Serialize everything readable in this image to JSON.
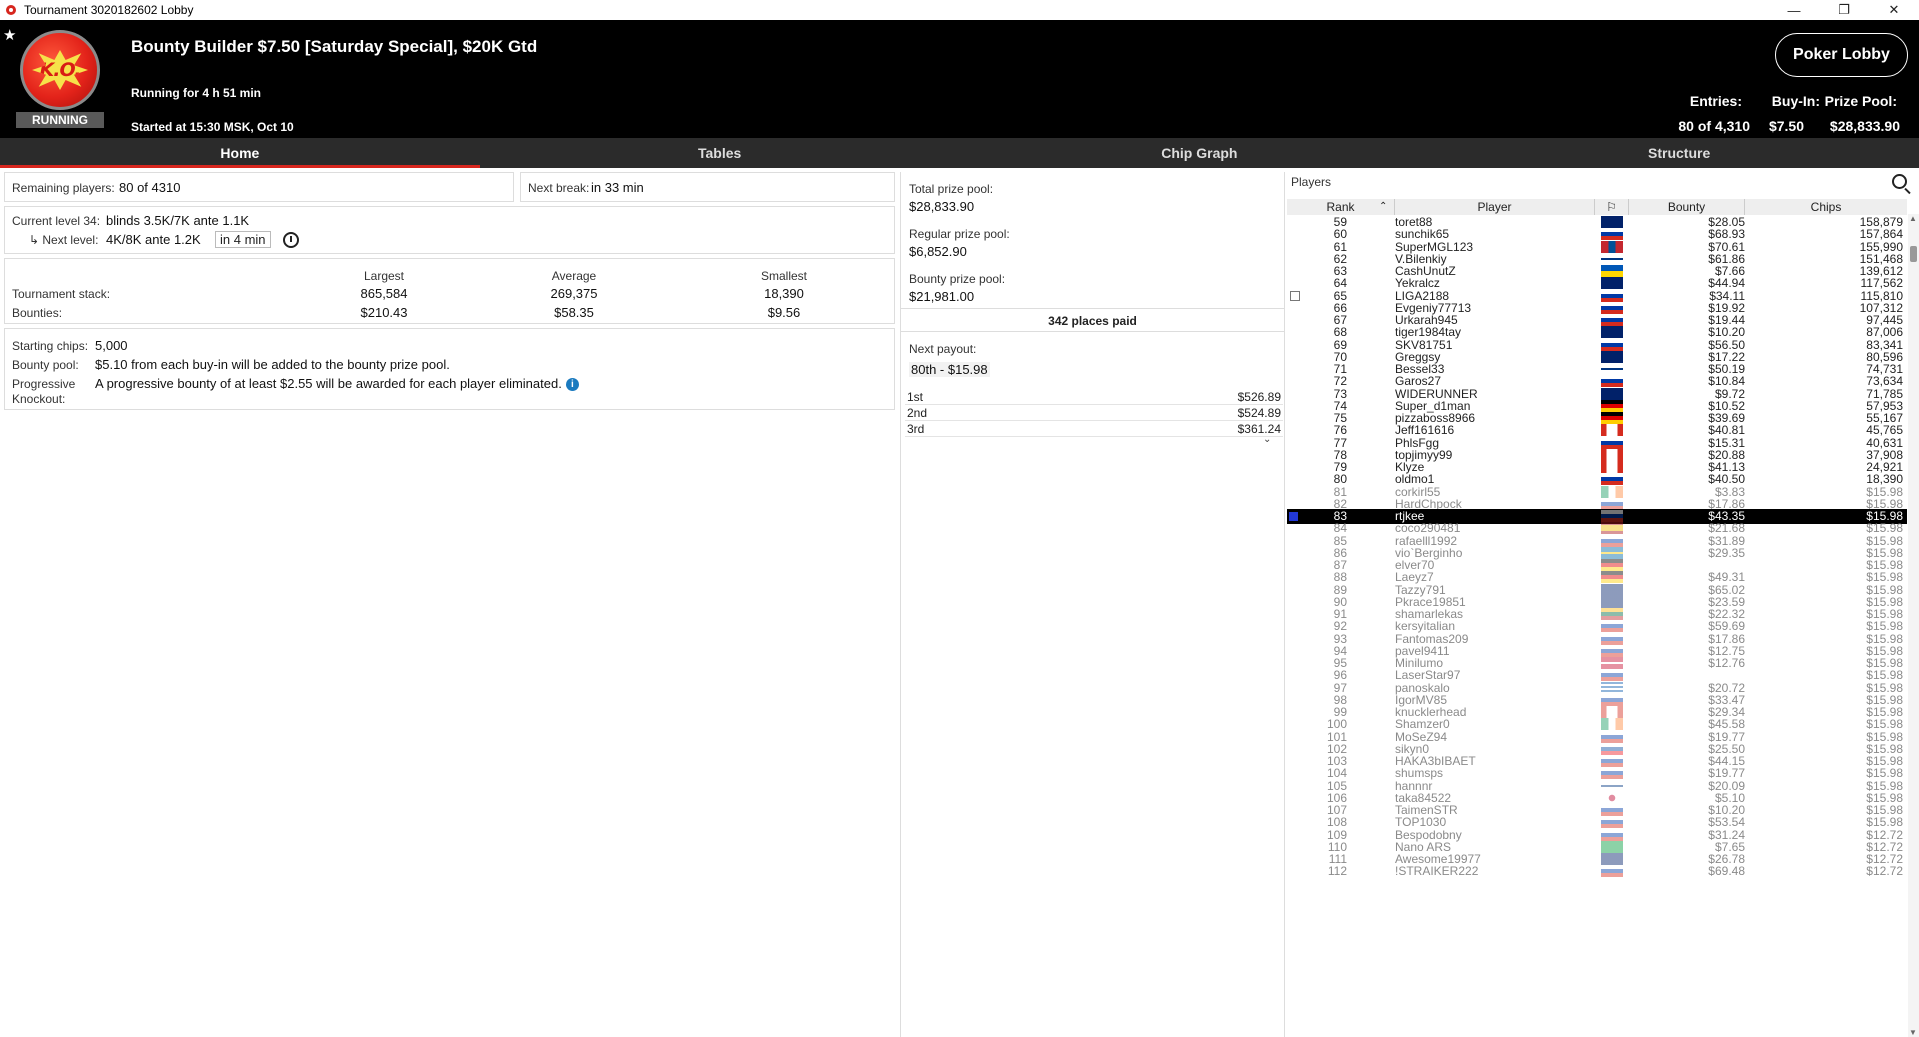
{
  "window": {
    "title": "Tournament 3020182602 Lobby",
    "minimize": "—",
    "restore": "❐",
    "close": "✕"
  },
  "header": {
    "logo_text": "K.O.",
    "status": "RUNNING",
    "tournament_name": "Bounty Builder $7.50 [Saturday Special], $20K Gtd",
    "running_for": "Running for 4 h 51 min",
    "started_at": "Started at 15:30 MSK, Oct 10",
    "lobby_button": "Poker Lobby",
    "entries_label": "Entries:",
    "entries_value": "80 of 4,310",
    "buyin_label": "Buy-In:",
    "buyin_value": "$7.50",
    "prizepool_label": "Prize Pool:",
    "prizepool_value": "$28,833.90"
  },
  "tabs": [
    "Home",
    "Tables",
    "Chip Graph",
    "Structure"
  ],
  "home": {
    "remaining_label": "Remaining players:",
    "remaining_value": "80 of 4310",
    "nextbreak_label": "Next break:",
    "nextbreak_value": "in 33 min",
    "current_level_label": "Current level 34:",
    "current_level_value": "blinds 3.5K/7K ante 1.1K",
    "next_level_label": "↳ Next level:",
    "next_level_value": "4K/8K ante 1.2K",
    "next_level_time": "in 4 min",
    "stack_headers": [
      "Largest",
      "Average",
      "Smallest"
    ],
    "tournament_stack_label": "Tournament stack:",
    "tournament_stack": [
      "865,584",
      "269,375",
      "18,390"
    ],
    "bounties_label": "Bounties:",
    "bounties": [
      "$210.43",
      "$58.35",
      "$9.56"
    ],
    "starting_chips_label": "Starting chips:",
    "starting_chips_value": "5,000",
    "bounty_pool_label": "Bounty pool:",
    "bounty_pool_value": "$5.10 from each buy-in will be added to the bounty prize pool.",
    "pko_label": "Progressive Knockout:",
    "pko_value": "A progressive bounty of at least $2.55 will be awarded for each player eliminated."
  },
  "prize": {
    "total_label": "Total prize pool:",
    "total_value": "$28,833.90",
    "regular_label": "Regular prize pool:",
    "regular_value": "$6,852.90",
    "bounty_label": "Bounty prize pool:",
    "bounty_value": "$21,981.00",
    "places_paid": "342 places paid",
    "next_payout_label": "Next payout:",
    "next_payout_value": "80th - $15.98",
    "payouts": [
      {
        "place": "1st",
        "amount": "$526.89"
      },
      {
        "place": "2nd",
        "amount": "$524.89"
      },
      {
        "place": "3rd",
        "amount": "$361.24"
      }
    ]
  },
  "players": {
    "title": "Players",
    "columns": [
      "Rank",
      "Player",
      "Bounty",
      "Chips"
    ],
    "rows": [
      {
        "rank": "59",
        "name": "toret88",
        "flag": "gb",
        "bounty": "$28.05",
        "chips": "158,879",
        "out": false
      },
      {
        "rank": "60",
        "name": "sunchik65",
        "flag": "ru",
        "bounty": "$68.93",
        "chips": "157,864",
        "out": false
      },
      {
        "rank": "61",
        "name": "SuperMGL123",
        "flag": "mn",
        "bounty": "$70.61",
        "chips": "155,990",
        "out": false
      },
      {
        "rank": "62",
        "name": "V.Bilenkiy",
        "flag": "fi",
        "bounty": "$61.86",
        "chips": "151,468",
        "out": false
      },
      {
        "rank": "63",
        "name": "CashUnutZ",
        "flag": "ua",
        "bounty": "$7.66",
        "chips": "139,612",
        "out": false
      },
      {
        "rank": "64",
        "name": "Yekralcz",
        "flag": "gb",
        "bounty": "$44.94",
        "chips": "117,562",
        "out": false
      },
      {
        "rank": "65",
        "name": "LIGA2188",
        "flag": "ru",
        "bounty": "$34.11",
        "chips": "115,810",
        "out": false,
        "check": true
      },
      {
        "rank": "66",
        "name": "Evgeniy77713",
        "flag": "ru",
        "bounty": "$19.92",
        "chips": "107,312",
        "out": false
      },
      {
        "rank": "67",
        "name": "Urkarah945",
        "flag": "ru",
        "bounty": "$19.44",
        "chips": "97,445",
        "out": false
      },
      {
        "rank": "68",
        "name": "tiger1984tay",
        "flag": "gb",
        "bounty": "$10.20",
        "chips": "87,006",
        "out": false
      },
      {
        "rank": "69",
        "name": "SKV81751",
        "flag": "ru",
        "bounty": "$56.50",
        "chips": "83,341",
        "out": false
      },
      {
        "rank": "70",
        "name": "Greggsy",
        "flag": "gb",
        "bounty": "$17.22",
        "chips": "80,596",
        "out": false
      },
      {
        "rank": "71",
        "name": "Bessel33",
        "flag": "fi",
        "bounty": "$50.19",
        "chips": "74,731",
        "out": false
      },
      {
        "rank": "72",
        "name": "Garos27",
        "flag": "ru",
        "bounty": "$10.84",
        "chips": "73,634",
        "out": false
      },
      {
        "rank": "73",
        "name": "WIDERUNNER",
        "flag": "gb",
        "bounty": "$9.72",
        "chips": "71,785",
        "out": false
      },
      {
        "rank": "74",
        "name": "Super_d1man",
        "flag": "de",
        "bounty": "$10.52",
        "chips": "57,953",
        "out": false
      },
      {
        "rank": "75",
        "name": "pizzaboss8966",
        "flag": "de",
        "bounty": "$39.69",
        "chips": "55,167",
        "out": false
      },
      {
        "rank": "76",
        "name": "Jeff161616",
        "flag": "ca",
        "bounty": "$40.81",
        "chips": "45,765",
        "out": false
      },
      {
        "rank": "77",
        "name": "PhlsFgg",
        "flag": "ru",
        "bounty": "$15.31",
        "chips": "40,631",
        "out": false
      },
      {
        "rank": "78",
        "name": "topjimyy99",
        "flag": "ca",
        "bounty": "$20.88",
        "chips": "37,908",
        "out": false
      },
      {
        "rank": "79",
        "name": "Klyze",
        "flag": "ca",
        "bounty": "$41.13",
        "chips": "24,921",
        "out": false
      },
      {
        "rank": "80",
        "name": "oldmo1",
        "flag": "ru",
        "bounty": "$40.50",
        "chips": "18,390",
        "out": false
      },
      {
        "rank": "81",
        "name": "corkirl55",
        "flag": "ie",
        "bounty": "$3.83",
        "chips": "$15.98",
        "out": true
      },
      {
        "rank": "82",
        "name": "HardChpock",
        "flag": "ru",
        "bounty": "$17.86",
        "chips": "$15.98",
        "out": true
      },
      {
        "rank": "83",
        "name": "rtjkee",
        "flag": "ru",
        "bounty": "$43.35",
        "chips": "$15.98",
        "out": true,
        "selected": true
      },
      {
        "rank": "84",
        "name": "coco290481",
        "flag": "es",
        "bounty": "$21.68",
        "chips": "$15.98",
        "out": true
      },
      {
        "rank": "85",
        "name": "rafaelll1992",
        "flag": "ru",
        "bounty": "$31.89",
        "chips": "$15.98",
        "out": true
      },
      {
        "rank": "86",
        "name": "vio`Berginho",
        "flag": "se",
        "bounty": "$29.35",
        "chips": "$15.98",
        "out": true
      },
      {
        "rank": "87",
        "name": "elver70",
        "flag": "de",
        "bounty": "",
        "chips": "$15.98",
        "out": true
      },
      {
        "rank": "88",
        "name": "Laeyz7",
        "flag": "de",
        "bounty": "$49.31",
        "chips": "$15.98",
        "out": true
      },
      {
        "rank": "89",
        "name": "Tazzy791",
        "flag": "gb",
        "bounty": "$65.02",
        "chips": "$15.98",
        "out": true
      },
      {
        "rank": "90",
        "name": "Pkrace19851",
        "flag": "gb",
        "bounty": "$23.59",
        "chips": "$15.98",
        "out": true
      },
      {
        "rank": "91",
        "name": "shamarlekas",
        "flag": "lt",
        "bounty": "$22.32",
        "chips": "$15.98",
        "out": true
      },
      {
        "rank": "92",
        "name": "kersyitalian",
        "flag": "ru",
        "bounty": "$59.69",
        "chips": "$15.98",
        "out": true
      },
      {
        "rank": "93",
        "name": "Fantomas209",
        "flag": "ru",
        "bounty": "$17.86",
        "chips": "$15.98",
        "out": true
      },
      {
        "rank": "94",
        "name": "pavel9411",
        "flag": "ru",
        "bounty": "$12.75",
        "chips": "$15.98",
        "out": true
      },
      {
        "rank": "95",
        "name": "Minilumo",
        "flag": "dk",
        "bounty": "$12.76",
        "chips": "$15.98",
        "out": true
      },
      {
        "rank": "96",
        "name": "LaserStar97",
        "flag": "ru",
        "bounty": "",
        "chips": "$15.98",
        "out": true
      },
      {
        "rank": "97",
        "name": "panoskalo",
        "flag": "gr",
        "bounty": "$20.72",
        "chips": "$15.98",
        "out": true
      },
      {
        "rank": "98",
        "name": "IgorMV85",
        "flag": "ru",
        "bounty": "$33.47",
        "chips": "$15.98",
        "out": true
      },
      {
        "rank": "99",
        "name": "knucklerhead",
        "flag": "ca",
        "bounty": "$29.34",
        "chips": "$15.98",
        "out": true
      },
      {
        "rank": "100",
        "name": "Shamzer0",
        "flag": "ie",
        "bounty": "$45.58",
        "chips": "$15.98",
        "out": true
      },
      {
        "rank": "101",
        "name": "MoSeZ94",
        "flag": "ru",
        "bounty": "$19.77",
        "chips": "$15.98",
        "out": true
      },
      {
        "rank": "102",
        "name": "sikyn0",
        "flag": "sk",
        "bounty": "$25.50",
        "chips": "$15.98",
        "out": true
      },
      {
        "rank": "103",
        "name": "HAKA3bIBAET",
        "flag": "ru",
        "bounty": "$44.15",
        "chips": "$15.98",
        "out": true
      },
      {
        "rank": "104",
        "name": "shumsps",
        "flag": "ru",
        "bounty": "$19.77",
        "chips": "$15.98",
        "out": true
      },
      {
        "rank": "105",
        "name": "hannnr",
        "flag": "fi",
        "bounty": "$20.09",
        "chips": "$15.98",
        "out": true
      },
      {
        "rank": "106",
        "name": "taka84522",
        "flag": "jp",
        "bounty": "$5.10",
        "chips": "$15.98",
        "out": true
      },
      {
        "rank": "107",
        "name": "TaimenSTR",
        "flag": "ru",
        "bounty": "$10.20",
        "chips": "$15.98",
        "out": true
      },
      {
        "rank": "108",
        "name": "TOP1030",
        "flag": "ru",
        "bounty": "$53.54",
        "chips": "$15.98",
        "out": true
      },
      {
        "rank": "109",
        "name": "Bespodobny",
        "flag": "ru",
        "bounty": "$31.24",
        "chips": "$12.72",
        "out": true
      },
      {
        "rank": "110",
        "name": "Nano ARS",
        "flag": "br",
        "bounty": "$7.65",
        "chips": "$12.72",
        "out": true
      },
      {
        "rank": "111",
        "name": "Awesome19977",
        "flag": "gb",
        "bounty": "$26.78",
        "chips": "$12.72",
        "out": true
      },
      {
        "rank": "112",
        "name": "!STRAIKER222",
        "flag": "ru",
        "bounty": "$69.48",
        "chips": "$12.72",
        "out": true
      }
    ]
  },
  "colors": {
    "header_bg": "#000000",
    "accent": "#d7261e",
    "selected_row": "#000000",
    "marker": "#2238d6"
  }
}
